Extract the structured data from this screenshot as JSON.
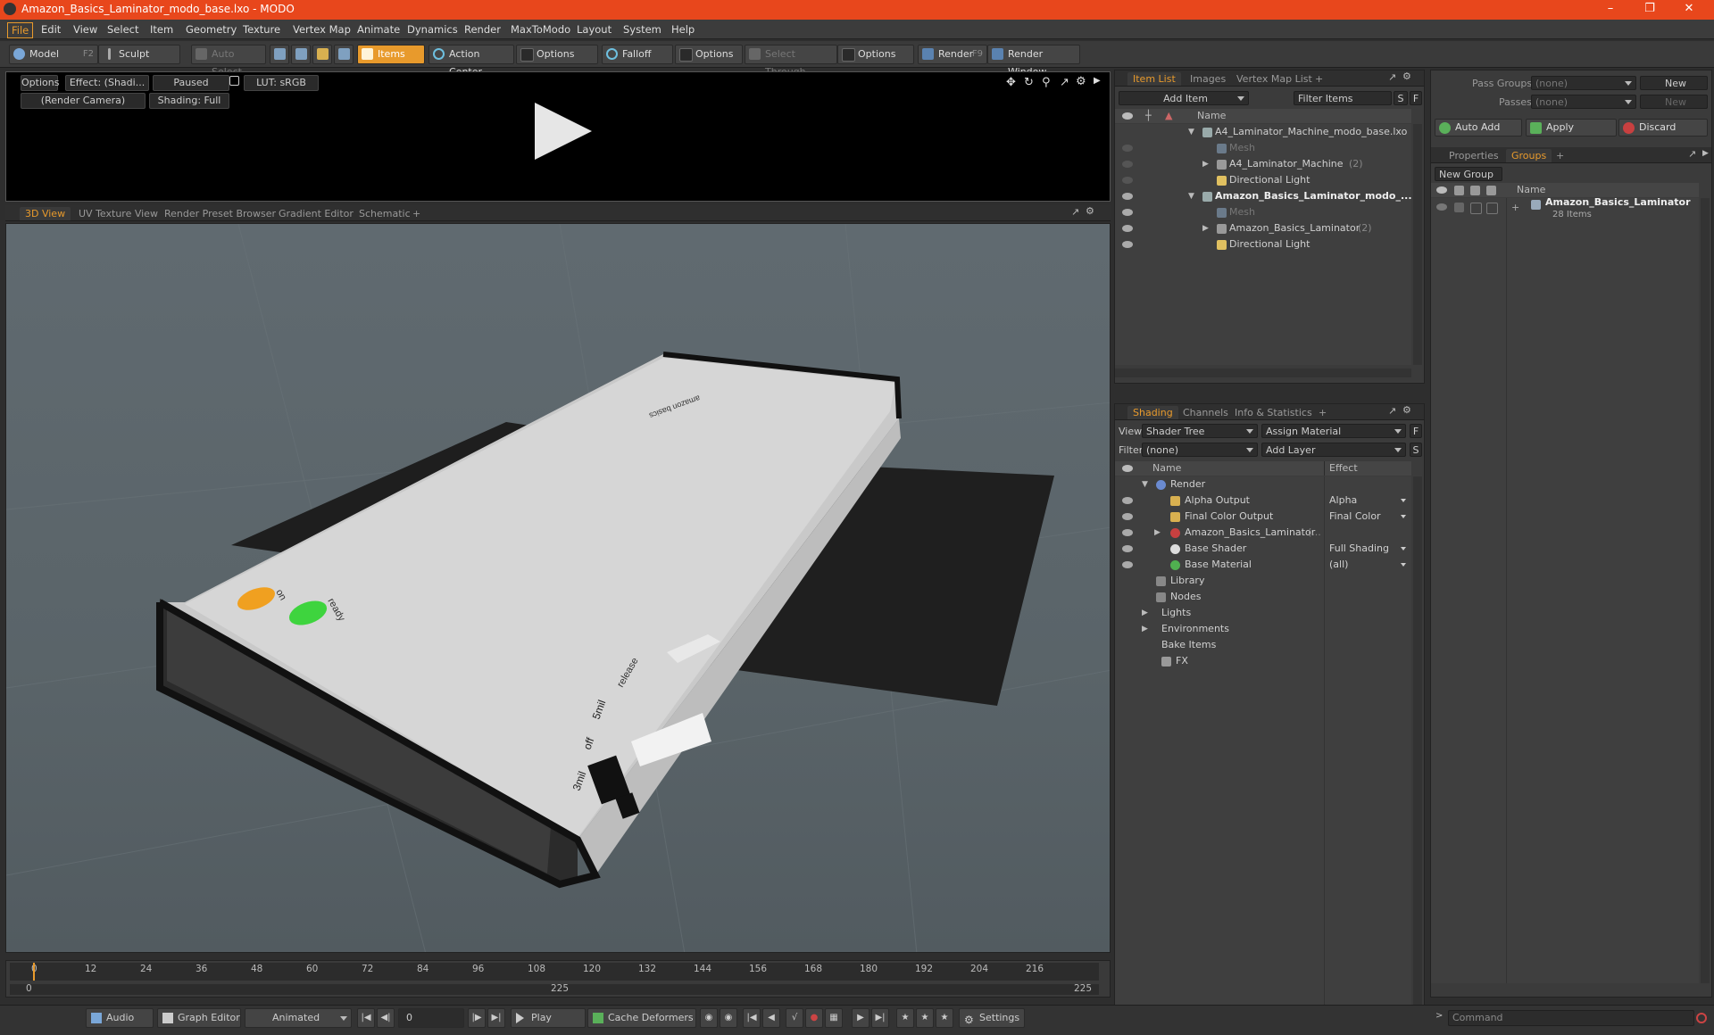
{
  "window": {
    "title": "Amazon_Basics_Laminator_modo_base.lxo - MODO"
  },
  "menu": [
    "File",
    "Edit",
    "View",
    "Select",
    "Item",
    "Geometry",
    "Texture",
    "Vertex Map",
    "Animate",
    "Dynamics",
    "Render",
    "MaxToModo",
    "Layout",
    "System",
    "Help"
  ],
  "toolbar": {
    "model": "Model",
    "model_key": "F2",
    "sculpt": "Sculpt",
    "auto_select": "Auto Select",
    "items": "Items",
    "action_center": "Action Center",
    "options1": "Options",
    "falloff": "Falloff",
    "options2": "Options",
    "select_through": "Select Through",
    "options3": "Options",
    "render": "Render",
    "render_key": "F9",
    "render_window": "Render Window"
  },
  "preview": {
    "options": "Options",
    "effect": "Effect: (Shadi...",
    "paused": "Paused",
    "lut": "LUT: sRGB",
    "camera": "(Render Camera)",
    "shading": "Shading: Full"
  },
  "viewport_tabs": [
    "3D View",
    "UV Texture View",
    "Render Preset Browser",
    "Gradient Editor",
    "Schematic"
  ],
  "item_list": {
    "tabs": [
      "Item List",
      "Images",
      "Vertex Map List"
    ],
    "add_item": "Add Item",
    "filter_items": "Filter Items",
    "s": "S",
    "f": "F",
    "col_name": "Name",
    "rows": [
      {
        "label": "A4_Laminator_Machine_modo_base.lxo",
        "bold": false,
        "indent": 0
      },
      {
        "label": "Mesh",
        "dim": true,
        "indent": 1
      },
      {
        "label": "A4_Laminator_Machine",
        "count": "(2)",
        "indent": 1
      },
      {
        "label": "Directional Light",
        "indent": 1
      },
      {
        "label": "Amazon_Basics_Laminator_modo_...",
        "bold": true,
        "indent": 0
      },
      {
        "label": "Mesh",
        "dim": true,
        "indent": 1
      },
      {
        "label": "Amazon_Basics_Laminator",
        "count": "(2)",
        "indent": 1
      },
      {
        "label": "Directional Light",
        "indent": 1
      }
    ]
  },
  "shading": {
    "tabs": [
      "Shading",
      "Channels",
      "Info & Statistics"
    ],
    "view_label": "View",
    "view_value": "Shader Tree",
    "assign_material": "Assign Material",
    "f": "F",
    "filter_label": "Filter",
    "filter_value": "(none)",
    "add_layer": "Add Layer",
    "s": "S",
    "col_name": "Name",
    "col_effect": "Effect",
    "rows": [
      {
        "label": "Render",
        "effect": ""
      },
      {
        "label": "Alpha Output",
        "effect": "Alpha"
      },
      {
        "label": "Final Color Output",
        "effect": "Final Color"
      },
      {
        "label": "Amazon_Basics_Laminator",
        "effect": "(..."
      },
      {
        "label": "Base Shader",
        "effect": "Full Shading"
      },
      {
        "label": "Base Material",
        "effect": "(all)"
      },
      {
        "label": "Library",
        "effect": ""
      },
      {
        "label": "Nodes",
        "effect": ""
      },
      {
        "label": "Lights",
        "effect": ""
      },
      {
        "label": "Environments",
        "effect": ""
      },
      {
        "label": "Bake Items",
        "effect": ""
      },
      {
        "label": "FX",
        "effect": ""
      }
    ]
  },
  "right_panel": {
    "pass_groups_label": "Pass Groups",
    "pass_groups_value": "(none)",
    "new1": "New",
    "passes_label": "Passes",
    "passes_value": "(none)",
    "new2": "New",
    "auto_add": "Auto Add",
    "apply": "Apply",
    "discard": "Discard",
    "tabs": [
      "Properties",
      "Groups"
    ],
    "new_group": "New Group",
    "col_name": "Name",
    "group_name": "Amazon_Basics_Laminator",
    "group_count": "28 Items"
  },
  "timeline": {
    "ticks": [
      "0",
      "12",
      "24",
      "36",
      "48",
      "60",
      "72",
      "84",
      "96",
      "108",
      "120",
      "132",
      "144",
      "156",
      "168",
      "180",
      "192",
      "204",
      "216"
    ],
    "start": "0",
    "mid": "225",
    "end": "225"
  },
  "bottombar": {
    "audio": "Audio",
    "graph_editor": "Graph Editor",
    "animated": "Animated",
    "frame": "0",
    "play": "Play",
    "cache_deformers": "Cache Deformers",
    "settings": "Settings",
    "command": "Command"
  },
  "model_labels": {
    "on": "on",
    "ready": "ready",
    "release": "release",
    "mil_a": "3mil",
    "off_a": "off",
    "mil_b": "5mil",
    "brand": "amazon basics"
  },
  "colors": {
    "accent": "#e89a2c",
    "titlebar": "#e8471c",
    "led_on": "#f0a020",
    "led_ready": "#3ed43e"
  }
}
